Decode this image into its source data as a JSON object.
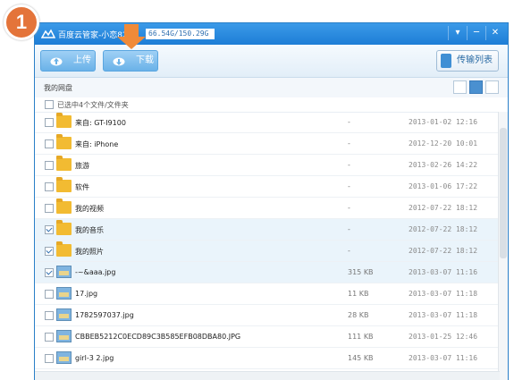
{
  "badge": "1",
  "titlebar": {
    "title": "百度云管家-小恋82",
    "quota": "66.54G/150.29G",
    "min": "─",
    "close": "✕",
    "menu": "▾"
  },
  "toolbar": {
    "upload_label": "上传",
    "download_label": "下载",
    "transfer_label": "传输列表"
  },
  "pathbar": {
    "path": "我的网盘"
  },
  "selection": {
    "text": "已选中4个文件/文件夹"
  },
  "files": [
    {
      "name": "来自: GT-I9100",
      "size": "-",
      "date": "2013-01-02 12:16",
      "type": "folder",
      "checked": false
    },
    {
      "name": "来自: iPhone",
      "size": "-",
      "date": "2012-12-20 10:01",
      "type": "folder",
      "checked": false
    },
    {
      "name": "旅游",
      "size": "-",
      "date": "2013-02-26 14:22",
      "type": "folder",
      "checked": false
    },
    {
      "name": "软件",
      "size": "-",
      "date": "2013-01-06 17:22",
      "type": "folder",
      "checked": false
    },
    {
      "name": "我的视频",
      "size": "-",
      "date": "2012-07-22 18:12",
      "type": "folder",
      "checked": false
    },
    {
      "name": "我的音乐",
      "size": "-",
      "date": "2012-07-22 18:12",
      "type": "folder",
      "checked": true
    },
    {
      "name": "我的照片",
      "size": "-",
      "date": "2012-07-22 18:12",
      "type": "folder",
      "checked": true
    },
    {
      "name": "-~&aaa.jpg",
      "size": "315 KB",
      "date": "2013-03-07 11:16",
      "type": "image",
      "checked": true
    },
    {
      "name": "17.jpg",
      "size": "11 KB",
      "date": "2013-03-07 11:18",
      "type": "image",
      "checked": false
    },
    {
      "name": "1782597037.jpg",
      "size": "28 KB",
      "date": "2013-03-07 11:18",
      "type": "image",
      "checked": false
    },
    {
      "name": "CBBEB5212C0ECD89C3B585EFB08DBA80.JPG",
      "size": "111 KB",
      "date": "2013-01-25 12:46",
      "type": "image",
      "checked": false
    },
    {
      "name": "girl-3 2.jpg",
      "size": "145 KB",
      "date": "2013-03-07 11:16",
      "type": "image",
      "checked": false
    }
  ]
}
